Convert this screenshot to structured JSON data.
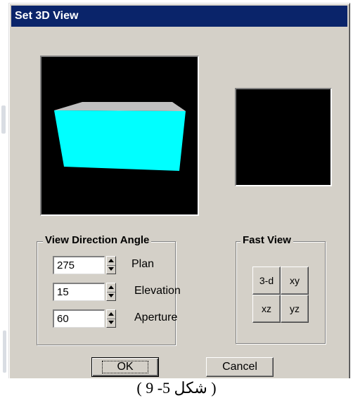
{
  "dialog": {
    "title": "Set 3D View",
    "title_color": "#0a246a",
    "face_color": "#d4d0c8"
  },
  "preview": {
    "background": "#000000",
    "box_front_color": "#00ffff",
    "box_top_color": "#c0c0c0"
  },
  "view_direction": {
    "title": "View Direction Angle",
    "plan": {
      "value": "275",
      "label": "Plan"
    },
    "elevation": {
      "value": "15",
      "label": "Elevation"
    },
    "aperture": {
      "value": "60",
      "label": "Aperture"
    }
  },
  "fast_view": {
    "title": "Fast View",
    "buttons": [
      "3-d",
      "xy",
      "xz",
      "yz"
    ]
  },
  "actions": {
    "ok_label": "OK",
    "cancel_label": "Cancel"
  },
  "caption": "( شكل 5- 9 )",
  "icons": [
    "spin-up-icon",
    "spin-down-icon"
  ]
}
